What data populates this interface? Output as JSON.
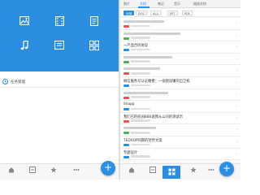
{
  "accent": "#2b8ee0",
  "left": {
    "grid": [
      {
        "label": "",
        "icon": "image-icon"
      },
      {
        "label": "",
        "icon": "video-icon"
      },
      {
        "label": "",
        "icon": "document-icon"
      },
      {
        "label": "",
        "icon": "music-icon"
      },
      {
        "label": "",
        "icon": "folder-icon"
      },
      {
        "label": "",
        "icon": "apps-icon"
      }
    ],
    "task_manager": "任务管理",
    "tabs": [
      {
        "label": "",
        "icon": "home-icon"
      },
      {
        "label": "",
        "icon": "share-icon"
      },
      {
        "label": "",
        "icon": "star-icon"
      },
      {
        "label": "",
        "icon": "more-icon"
      }
    ],
    "fab": "+"
  },
  "right": {
    "nav": [
      {
        "label": "图片",
        "active": false
      },
      {
        "label": "文档",
        "active": true
      },
      {
        "label": "笔记",
        "active": false
      },
      {
        "label": "音乐",
        "active": false
      },
      {
        "label": "链接文档",
        "active": false
      }
    ],
    "filters": [
      {
        "label": "全部",
        "active": true
      },
      {
        "label": "DOC",
        "active": false
      },
      {
        "label": "XLS",
        "active": false
      },
      {
        "label": "PPT",
        "active": false
      },
      {
        "label": "PDF",
        "active": false
      }
    ],
    "files": [
      {
        "title": "",
        "badge": "#e9534b"
      },
      {
        "title": "",
        "badge": "#4bb04f"
      },
      {
        "title": "一产品合同协议",
        "badge": "#2b8ee0"
      },
      {
        "title": "",
        "badge": "#4bb04f"
      },
      {
        "title": "",
        "badge": "#e9534b"
      },
      {
        "title": "微信服务号认证缴费：一张图读懂的自卫机",
        "badge": "#2b8ee0"
      },
      {
        "title": "",
        "badge": "#e9534b"
      },
      {
        "title": "Snapp",
        "badge": "#2b8ee0"
      },
      {
        "title": "我们已的校园BBS说我从公司的测试示",
        "badge": "#e9534b"
      },
      {
        "title": "",
        "badge": "#4bb04f"
      },
      {
        "title": "TEDXDP同期的宣传文案",
        "badge": "#2b8ee0"
      },
      {
        "title": "专题设计",
        "badge": "#2b8ee0"
      },
      {
        "title": "",
        "badge": "#4bb04f"
      }
    ],
    "fab": "+"
  }
}
